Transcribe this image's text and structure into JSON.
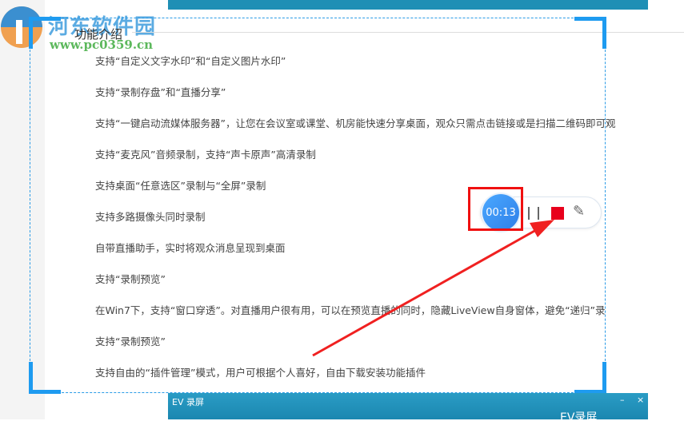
{
  "watermark": {
    "title": "河东软件园",
    "url": "www.pc0359.cn"
  },
  "heading": "功能介绍",
  "features": [
    "支持“自定义文字水印”和“自定义图片水印”",
    "支持“录制存盘”和“直播分享”",
    "支持“一键启动流媒体服务器”，让您在会议室或课堂、机房能快速分享桌面，观众只需点击链接或是扫描二维码即可观",
    "支持“麦克风”音频录制，支持“声卡原声”高清录制",
    "支持桌面“任意选区”录制与“全屏”录制",
    "支持多路摄像头同时录制",
    "自带直播助手，实时将观众消息呈现到桌面",
    "支持“录制预览”",
    "在Win7下，支持“窗口穿透”。对直播用户很有用，可以在预览直播的同时，隐藏LiveView自身窗体，避免“递归”录",
    "支持“录制预览”",
    "支持自由的“插件管理”模式，用户可根据个人喜好，自由下载安装功能插件"
  ],
  "recorder": {
    "timer": "00:13"
  },
  "app_window": {
    "title": "EV 录屏",
    "minimize": "–",
    "close": "×",
    "brand": "EV录屏"
  },
  "colors": {
    "accent": "#1e9bf0",
    "highlight": "#f01010",
    "stop": "#e8001c"
  }
}
